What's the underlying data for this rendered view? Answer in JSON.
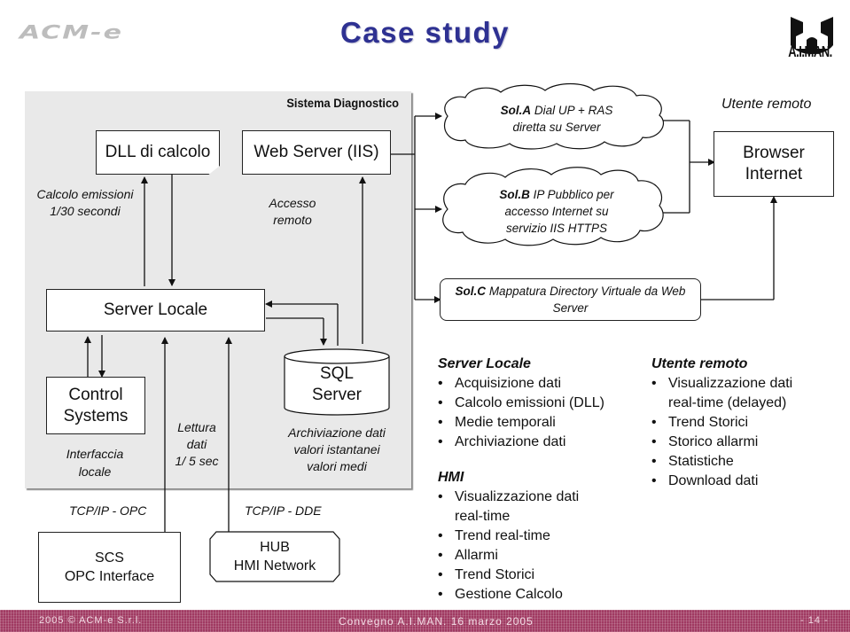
{
  "header": {
    "logo_left": "ACM-e",
    "title": "Case study",
    "logo_right": "A.I.MAN."
  },
  "diagram": {
    "panel_title": "Sistema Diagnostico",
    "dll_box": "DLL di calcolo",
    "web_server_box": "Web Server (IIS)",
    "calc_note_line1": "Calcolo emissioni",
    "calc_note_line2": "1/30 secondi",
    "remote_note_line1": "Accesso",
    "remote_note_line2": "remoto",
    "server_locale_box": "Server Locale",
    "control_systems_line1": "Control",
    "control_systems_line2": "Systems",
    "interface_note_line1": "Interfaccia",
    "interface_note_line2": "locale",
    "read_note_line1": "Lettura",
    "read_note_line2": "dati",
    "read_note_line3": "1/ 5 sec",
    "sql_line1": "SQL",
    "sql_line2": "Server",
    "archive_note_line1": "Archiviazione dati",
    "archive_note_line2": "valori istantanei",
    "archive_note_line3": "valori medi",
    "tcp_opc": "TCP/IP - OPC",
    "tcp_dde": "TCP/IP - DDE",
    "scs_line1": "SCS",
    "scs_line2": "OPC Interface",
    "hub_line1": "HUB",
    "hub_line2": "HMI Network",
    "sol_a_bold": "Sol.A",
    "sol_a_rest": " Dial UP + RAS",
    "sol_a_line2": "diretta su Server",
    "sol_b_bold": "Sol.B",
    "sol_b_rest": " IP Pubblico per",
    "sol_b_line2": "accesso Internet su",
    "sol_b_line3": "servizio IIS HTTPS",
    "sol_c_bold": "Sol.C",
    "sol_c_rest": " Mappatura Directory Virtuale da Web",
    "sol_c_line2": "Server",
    "remote_user_label": "Utente remoto",
    "browser_line1": "Browser",
    "browser_line2": "Internet"
  },
  "lists": {
    "server_locale": {
      "heading": "Server Locale",
      "items": [
        "Acquisizione dati",
        "Calcolo emissioni (DLL)",
        "Medie temporali",
        "Archiviazione dati"
      ]
    },
    "hmi": {
      "heading": "HMI",
      "items": [
        "Visualizzazione dati real-time",
        "Trend real-time",
        "Allarmi",
        "Trend Storici",
        "Gestione Calcolo"
      ]
    },
    "utente_remoto": {
      "heading": "Utente remoto",
      "items": [
        "Visualizzazione dati real-time (delayed)",
        "Trend Storici",
        "Storico allarmi",
        "Statistiche",
        "Download dati"
      ]
    }
  },
  "footer": {
    "copyright": "2005 © ACM-e S.r.l.",
    "event": "Convegno A.I.MAN. 16 marzo 2005",
    "page": "- 14 -"
  },
  "colors": {
    "title": "#2e3192",
    "footer_bg": "#a03a62",
    "panel_bg": "#e9e9e9"
  }
}
